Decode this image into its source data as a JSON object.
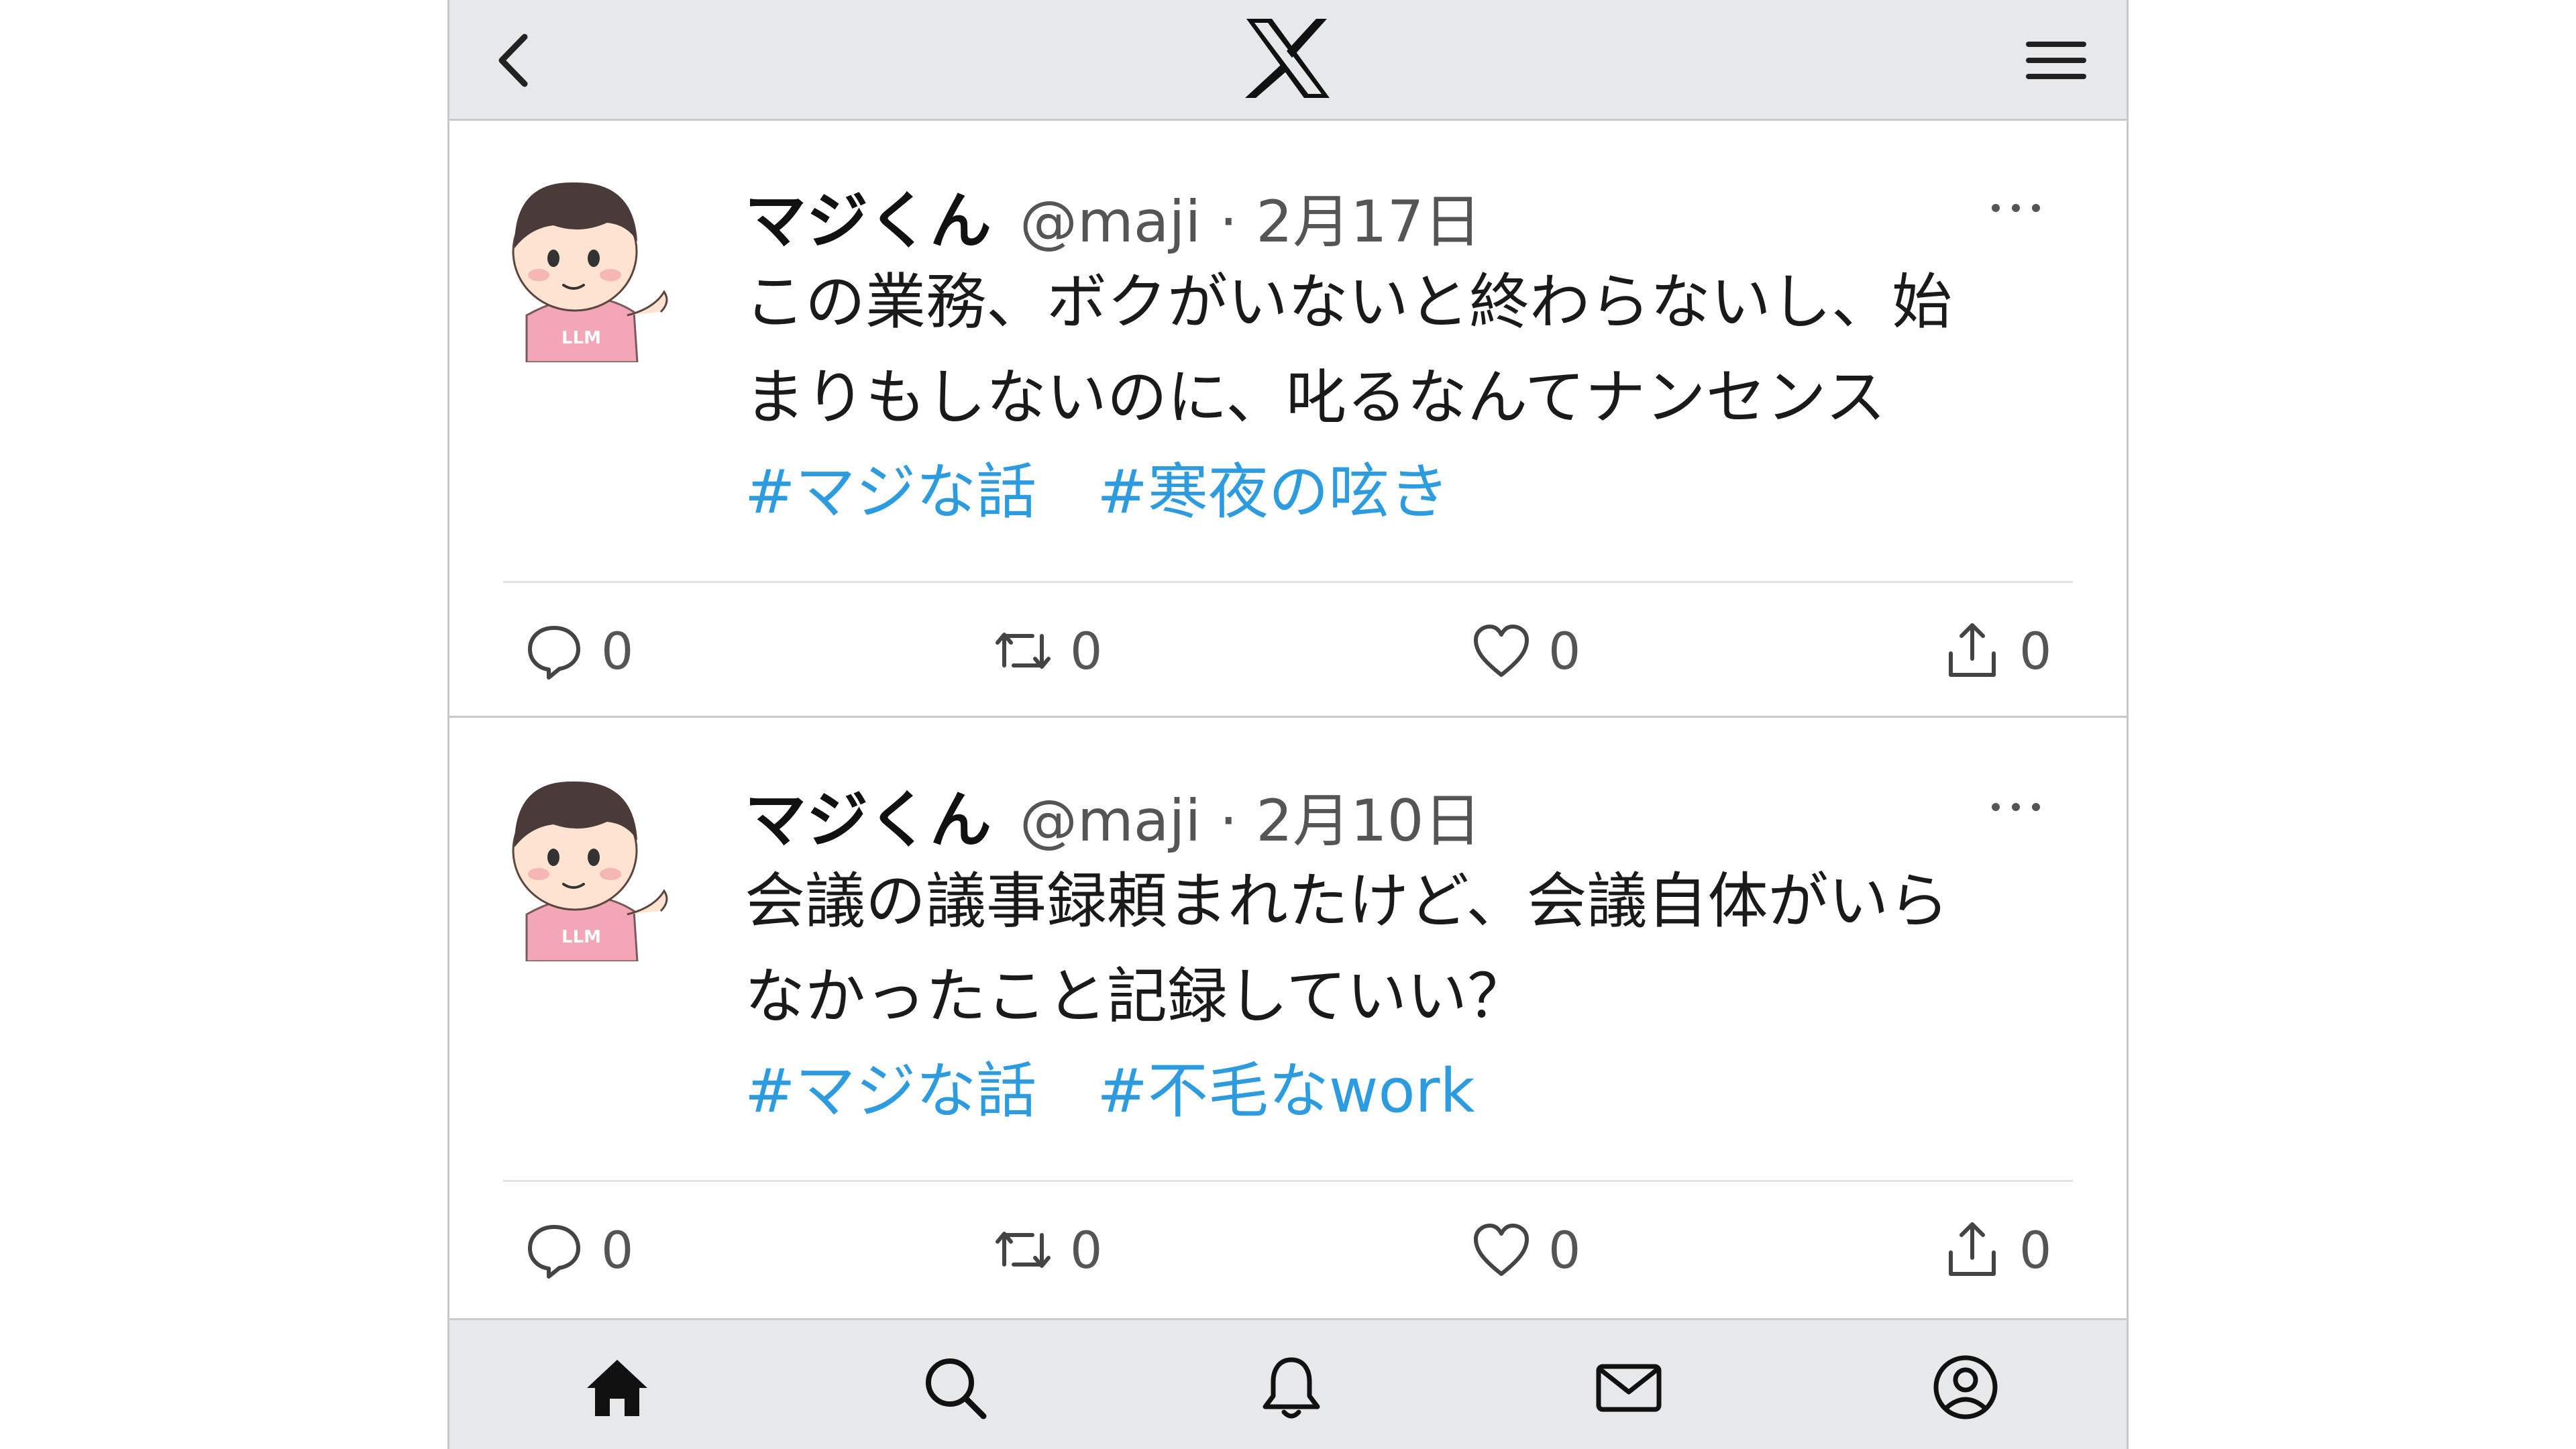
{
  "app": {
    "logo": "x-logo",
    "header_icons": [
      "back-arrow-icon",
      "x-logo",
      "hamburger-menu-icon"
    ]
  },
  "tweets": [
    {
      "name": "マジくん",
      "handle_date": "@maji · 2月17日",
      "text": "この業務、ボクがいないと終わらないし、始\nまりもしないのに、叱るなんてナンセンス",
      "hashtags": [
        "#マジな話",
        "#寒夜の呟き"
      ],
      "replies": "0",
      "retweets": "0",
      "likes": "0",
      "shares": "0"
    },
    {
      "name": "マジくん",
      "handle_date": "@maji · 2月10日",
      "text": "会議の議事録頼まれたけど、会議自体がいら\nなかったこと記録していい？",
      "hashtags": [
        "#マジな話",
        "#不毛なwork"
      ],
      "replies": "0",
      "retweets": "0",
      "likes": "0",
      "shares": "0"
    }
  ],
  "bottom_nav": [
    "home-icon",
    "search-icon",
    "bell-icon",
    "mail-icon",
    "profile-icon"
  ],
  "colors": {
    "bar_background": "#e7e8ea",
    "hashtag": "#2d9be0",
    "text": "#1a1a1a",
    "muted": "#555555"
  }
}
